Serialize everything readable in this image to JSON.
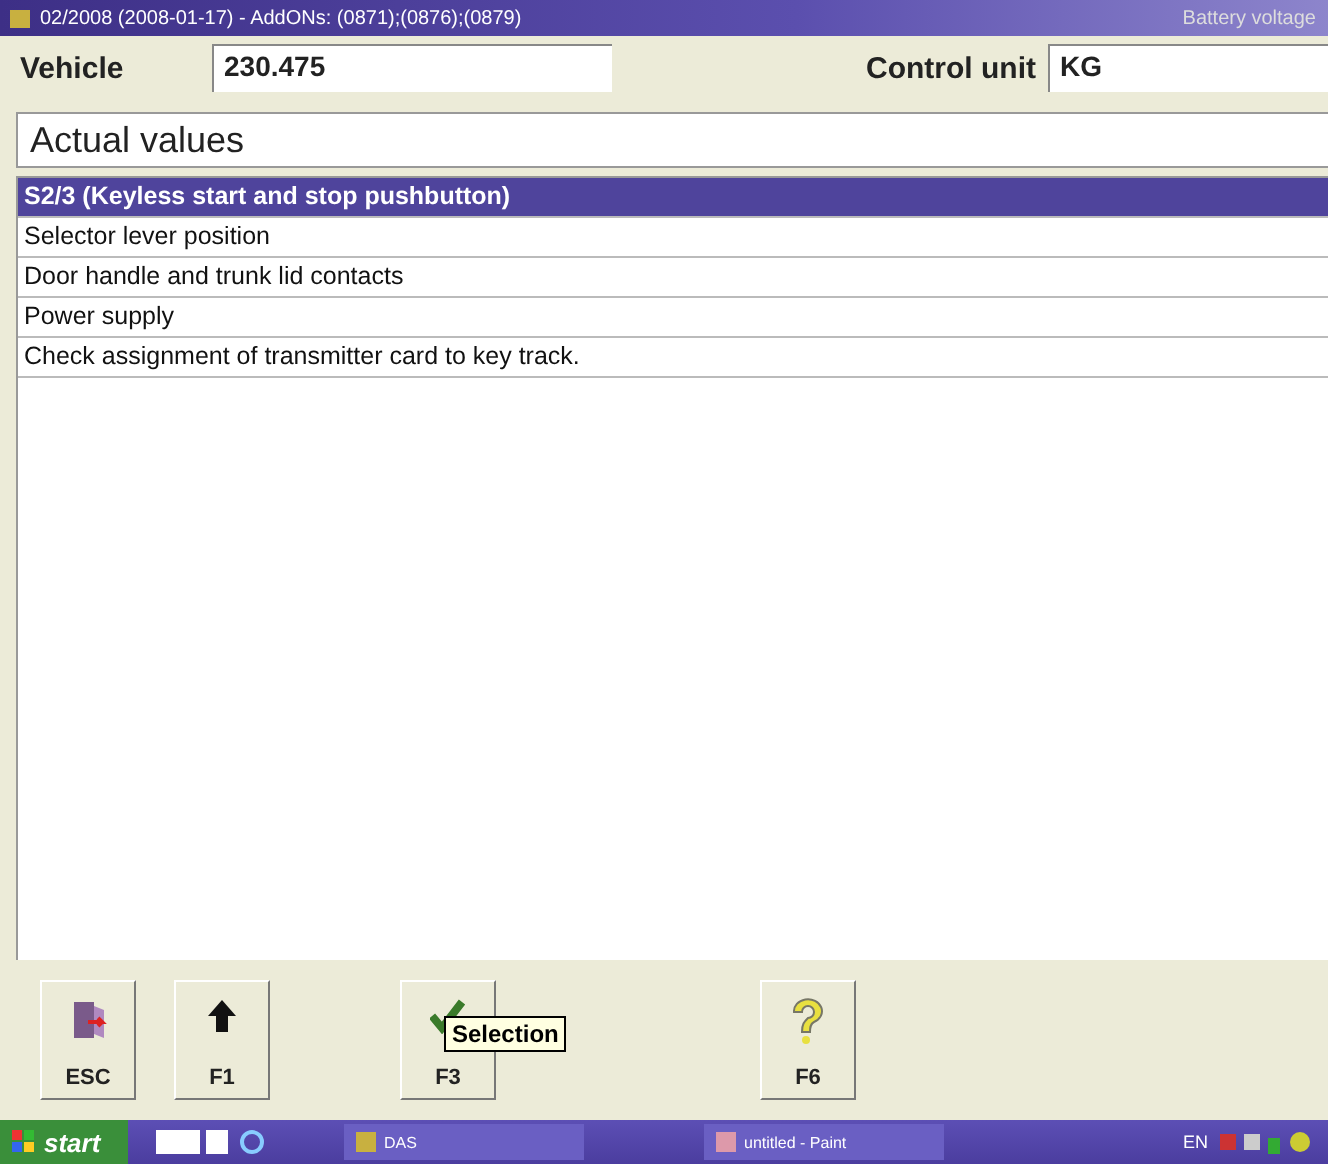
{
  "window": {
    "title": "02/2008 (2008-01-17) - AddONs: (0871);(0876);(0879)",
    "status": "Battery voltage"
  },
  "header": {
    "vehicle_label": "Vehicle",
    "vehicle_value": "230.475",
    "control_unit_label": "Control unit",
    "control_unit_value": "KG"
  },
  "section_title": "Actual values",
  "items": [
    {
      "label": "S2/3 (Keyless start and stop pushbutton)",
      "selected": true
    },
    {
      "label": "Selector lever position",
      "selected": false
    },
    {
      "label": "Door handle and trunk lid contacts",
      "selected": false
    },
    {
      "label": "Power supply",
      "selected": false
    },
    {
      "label": "Check assignment of transmitter card to key track.",
      "selected": false
    }
  ],
  "buttons": [
    {
      "kind": "exit",
      "label": "ESC"
    },
    {
      "kind": "up",
      "label": "F1"
    },
    {
      "kind": "check",
      "label": "F3",
      "tooltip": "Selection"
    },
    {
      "kind": "help",
      "label": "F6"
    }
  ],
  "taskbar": {
    "start": "start",
    "tasks": [
      {
        "label": "DAS",
        "kind": "das"
      },
      {
        "label": "untitled - Paint",
        "kind": "paint"
      }
    ],
    "language": "EN"
  }
}
